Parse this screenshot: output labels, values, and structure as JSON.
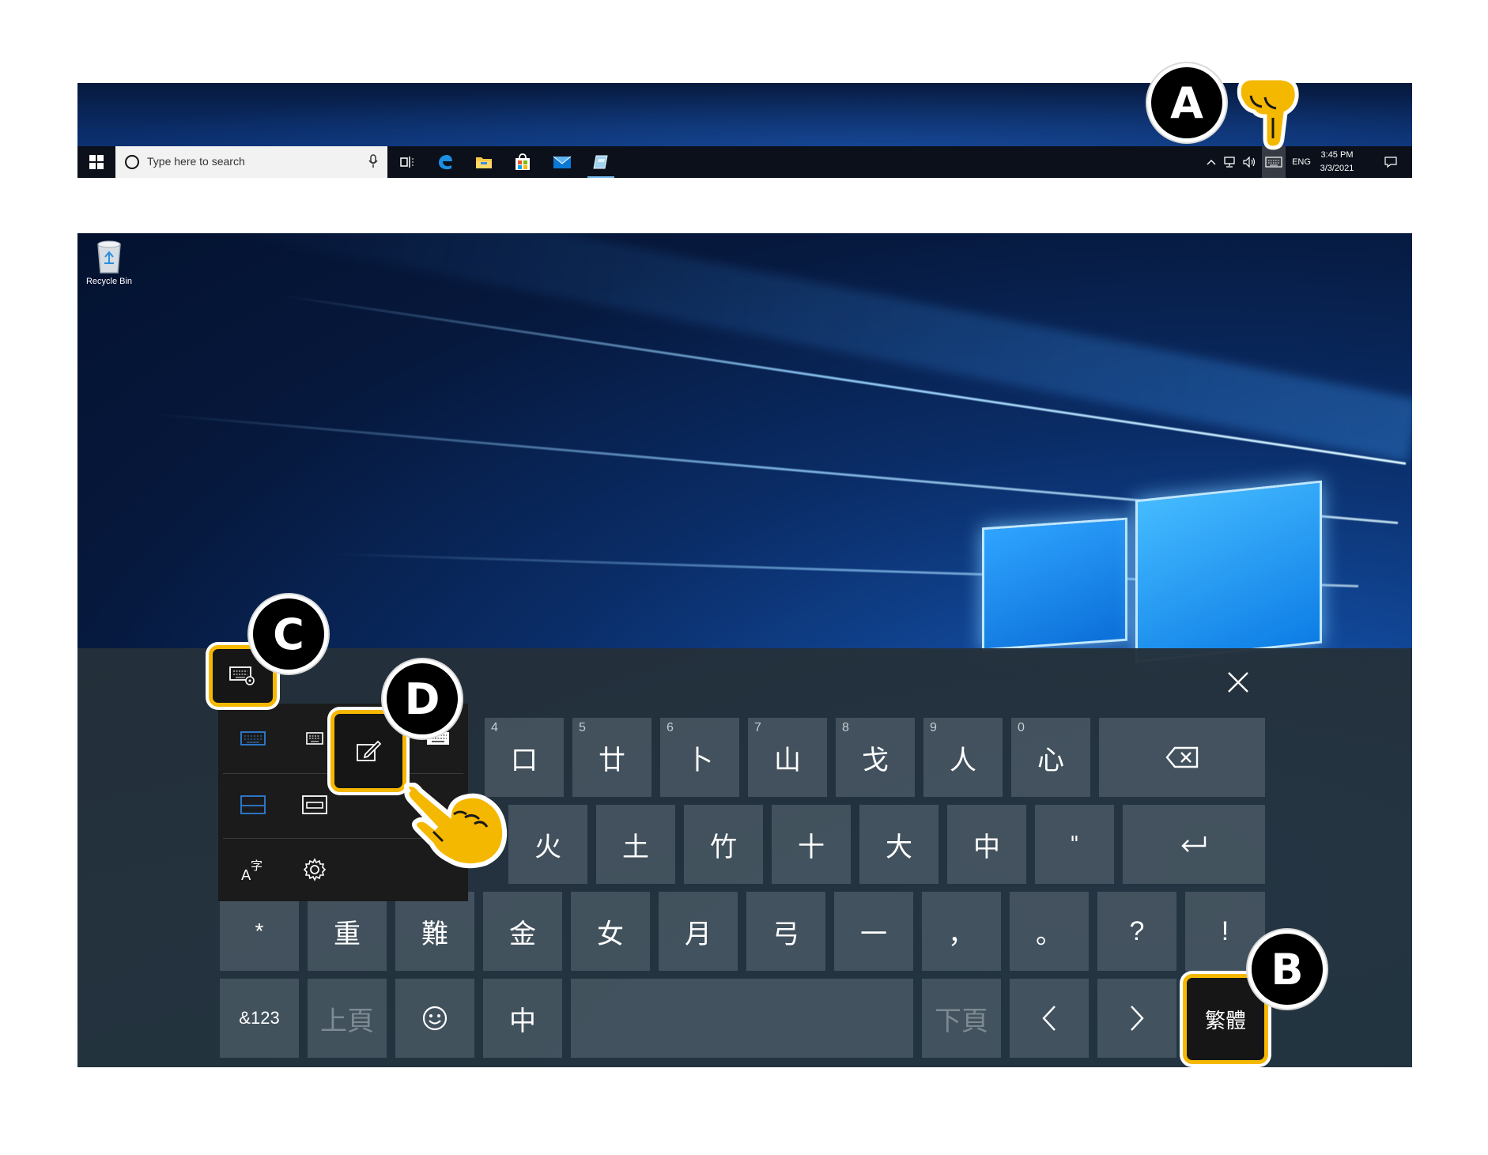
{
  "taskbar": {
    "search_placeholder": "Type here to search",
    "lang": "ENG",
    "time": "3:45 PM",
    "date": "3/3/2021",
    "icons": [
      "windows-start-icon",
      "cortana-circle-icon",
      "microphone-icon",
      "task-view-icon",
      "edge-icon",
      "file-explorer-icon",
      "store-icon",
      "mail-icon",
      "app-icon",
      "chevron-up-icon",
      "network-icon",
      "volume-icon",
      "touch-keyboard-icon",
      "action-center-icon"
    ]
  },
  "desktop": {
    "recycle_bin_label": "Recycle Bin"
  },
  "callouts": {
    "a": "A",
    "b": "B",
    "c": "C",
    "d": "D"
  },
  "keyboard": {
    "row1": [
      {
        "num": "4",
        "char": "口"
      },
      {
        "num": "5",
        "char": "廿"
      },
      {
        "num": "6",
        "char": "卜"
      },
      {
        "num": "7",
        "char": "山"
      },
      {
        "num": "8",
        "char": "戈"
      },
      {
        "num": "9",
        "char": "人"
      },
      {
        "num": "0",
        "char": "心"
      }
    ],
    "row2": [
      "火",
      "土",
      "竹",
      "十",
      "大",
      "中",
      "\""
    ],
    "row3": [
      "*",
      "重",
      "難",
      "金",
      "女",
      "月",
      "弓",
      "一",
      "，",
      "。",
      "?",
      "!"
    ],
    "row4": {
      "symbols": "&123",
      "page_up": "上頁",
      "zhong": "中",
      "page_down": "下頁",
      "left": "<",
      "right": ">",
      "ime_mode": "繁體"
    }
  },
  "colors": {
    "highlight": "#f5b800",
    "badge": "#000000",
    "accent_blue": "#0a78d7"
  }
}
